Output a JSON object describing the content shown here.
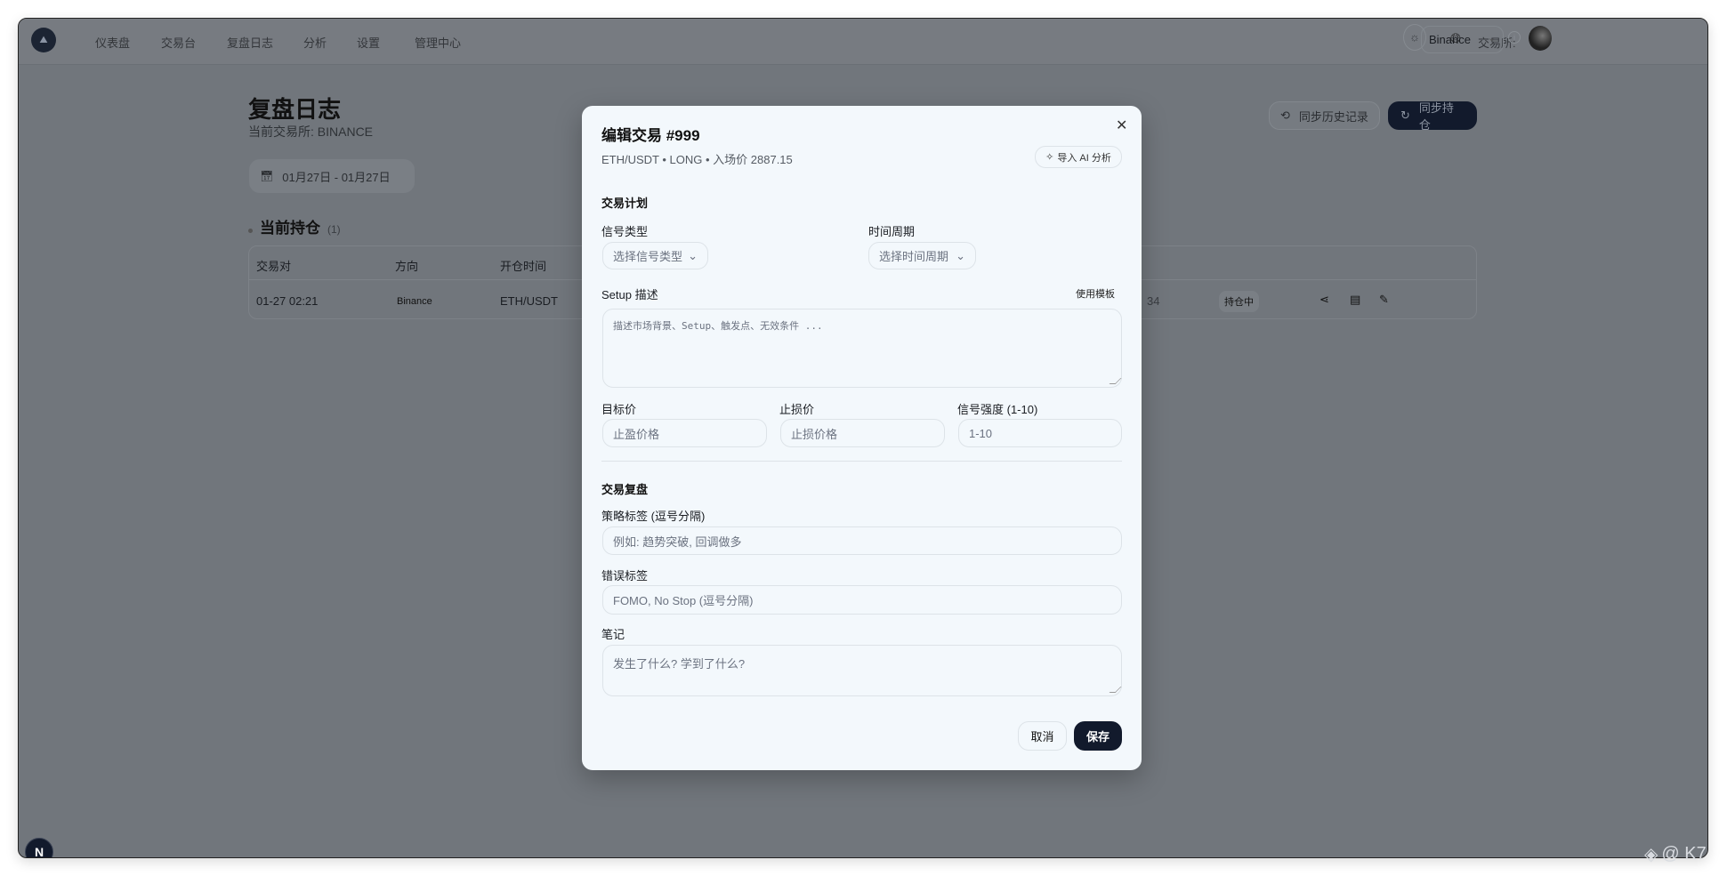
{
  "nav": {
    "items": [
      "仪表盘",
      "交易台",
      "复盘日志",
      "分析",
      "设置",
      "管理中心"
    ],
    "exchange_label": "交易所:",
    "exchange_value": "Binance"
  },
  "page": {
    "title": "复盘日志",
    "subtitle": "当前交易所: BINANCE",
    "date_range": "01月27日 - 01月27日",
    "sync_history": "同步历史记录",
    "sync_positions": "同步持仓"
  },
  "positions": {
    "title": "当前持仓",
    "count": "(1)",
    "headers": [
      "交易对",
      "方向",
      "开仓时间"
    ],
    "row": {
      "time": "01-27 02:21",
      "exchange": "Binance",
      "pair": "ETH/USDT",
      "partial": "34",
      "status": "持仓中"
    }
  },
  "modal": {
    "title": "编辑交易 #999",
    "subtitle": "ETH/USDT • LONG • 入场价 2887.15",
    "ai_button": "导入 AI 分析",
    "plan_heading": "交易计划",
    "signal_label": "信号类型",
    "signal_placeholder": "选择信号类型",
    "timeframe_label": "时间周期",
    "timeframe_placeholder": "选择时间周期",
    "setup_label": "Setup 描述",
    "template_link": "使用模板",
    "setup_placeholder": "描述市场背景、Setup、触发点、无效条件 ...",
    "target_label": "目标价",
    "target_placeholder": "止盈价格",
    "stop_label": "止损价",
    "stop_placeholder": "止损价格",
    "strength_label": "信号强度 (1-10)",
    "strength_placeholder": "1-10",
    "review_heading": "交易复盘",
    "strategy_label": "策略标签 (逗号分隔)",
    "strategy_placeholder": "例如: 趋势突破, 回调做多",
    "mistake_label": "错误标签",
    "mistake_placeholder": "FOMO, No Stop (逗号分隔)",
    "notes_label": "笔记",
    "notes_placeholder": "发生了什么? 学到了什么?",
    "cancel": "取消",
    "save": "保存"
  },
  "badge": "N",
  "watermark": "@ K7"
}
